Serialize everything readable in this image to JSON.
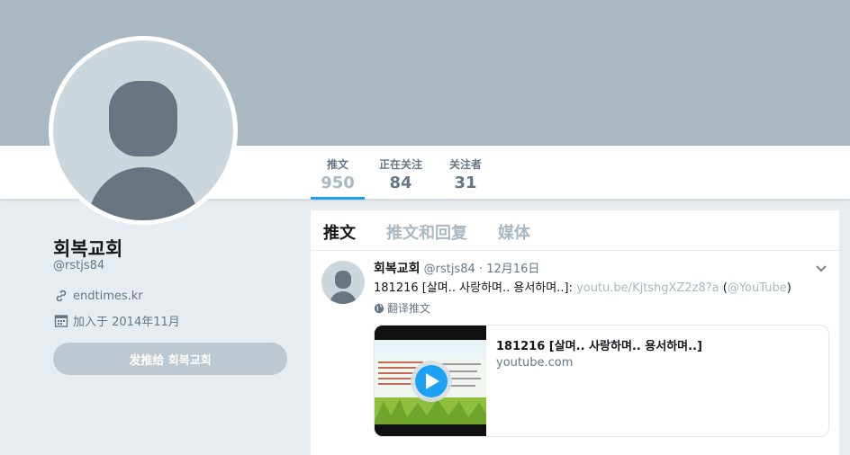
{
  "profile": {
    "name": "회복교회",
    "handle": "@rstjs84",
    "website": "endtimes.kr",
    "joined": "加入于 2014年11月",
    "tweet_to_button": "发推给 회복교회"
  },
  "stats": [
    {
      "label": "推文",
      "value": "950"
    },
    {
      "label": "正在关注",
      "value": "84"
    },
    {
      "label": "关注者",
      "value": "31"
    }
  ],
  "tabs": [
    "推文",
    "推文和回复",
    "媒体"
  ],
  "tweet": {
    "author_name": "회복교회",
    "author_handle": "@rstjs84",
    "separator": "·",
    "date": "12月16日",
    "text_prefix": "181216 [살며.. 사랑하며.. 용서하며..]: ",
    "link": "youtu.be/KjtshgXZ2z8?a",
    "paren_open": " (",
    "mention": "@YouTube",
    "paren_close": ")",
    "translate": "翻译推文",
    "card_title": "181216 [살며.. 사랑하며.. 용서하며..]",
    "card_domain": "youtube.com"
  },
  "colors": {
    "banner": "#aab8c2",
    "accent": "#1da1f2",
    "background": "#e6ecf0",
    "button": "#bdc8d0"
  },
  "icons": {
    "link": "link-icon",
    "calendar": "calendar-icon",
    "globe": "globe-icon",
    "chevron": "chevron-down-icon",
    "play": "play-icon"
  }
}
